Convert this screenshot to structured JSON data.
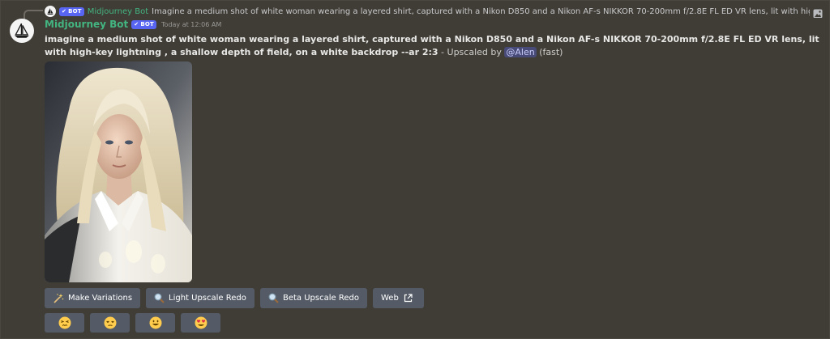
{
  "reply": {
    "author": "Midjourney Bot",
    "badge": "BOT",
    "text": "Imagine a medium shot of white woman wearing a layered shirt, captured with a Nikon D850 and a Nikon AF-s NIKKOR 70-200mm f/2.8E FL ED VR lens, lit with high-key l",
    "icon": "image-icon"
  },
  "message": {
    "author": "Midjourney Bot",
    "badge": "BOT",
    "timestamp": "Today at 12:06 AM",
    "prompt": "imagine a medium shot of white woman wearing a layered shirt, captured with a Nikon D850 and a Nikon AF-s NIKKOR 70-200mm f/2.8E FL ED VR lens, lit with high-key lightning , a shallow depth of field, on a white backdrop --ar 2:3",
    "upscaled_text": " - Upscaled by ",
    "mention": "@Alen",
    "mode": " (fast)",
    "author_color": "#43b581",
    "badge_color": "#5865f2"
  },
  "buttons": [
    {
      "label": "Make Variations",
      "icon": "sparkle-wand-icon"
    },
    {
      "label": "Light Upscale Redo",
      "icon": "magnifier-icon"
    },
    {
      "label": "Beta Upscale Redo",
      "icon": "magnifier-icon"
    },
    {
      "label": "Web",
      "icon": "external-link-icon"
    }
  ],
  "reactions": [
    {
      "emoji": "persevering-face-icon"
    },
    {
      "emoji": "unamused-face-icon"
    },
    {
      "emoji": "smiley-face-icon"
    },
    {
      "emoji": "heart-eyes-face-icon"
    }
  ]
}
